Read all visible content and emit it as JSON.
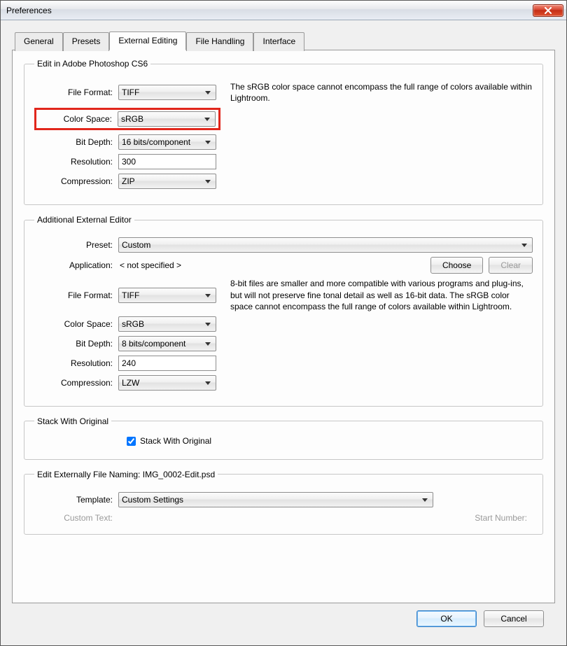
{
  "window": {
    "title": "Preferences"
  },
  "tabs": [
    "General",
    "Presets",
    "External Editing",
    "File Handling",
    "Interface"
  ],
  "active_tab_index": 2,
  "section1": {
    "legend": "Edit in Adobe Photoshop CS6",
    "file_format_label": "File Format:",
    "file_format_value": "TIFF",
    "color_space_label": "Color Space:",
    "color_space_value": "sRGB",
    "bit_depth_label": "Bit Depth:",
    "bit_depth_value": "16 bits/component",
    "resolution_label": "Resolution:",
    "resolution_value": "300",
    "compression_label": "Compression:",
    "compression_value": "ZIP",
    "info": "The sRGB color space cannot encompass the full range of colors available within Lightroom."
  },
  "section2": {
    "legend": "Additional External Editor",
    "preset_label": "Preset:",
    "preset_value": "Custom",
    "application_label": "Application:",
    "application_value": "< not specified >",
    "choose_label": "Choose",
    "clear_label": "Clear",
    "file_format_label": "File Format:",
    "file_format_value": "TIFF",
    "color_space_label": "Color Space:",
    "color_space_value": "sRGB",
    "bit_depth_label": "Bit Depth:",
    "bit_depth_value": "8 bits/component",
    "resolution_label": "Resolution:",
    "resolution_value": "240",
    "compression_label": "Compression:",
    "compression_value": "LZW",
    "info": "8-bit files are smaller and more compatible with various programs and plug-ins, but will not preserve fine tonal detail as well as 16-bit data. The sRGB color space cannot encompass the full range of colors available within Lightroom."
  },
  "section3": {
    "legend": "Stack With Original",
    "checkbox_label": "Stack With Original",
    "checked": true
  },
  "section4": {
    "legend_prefix": "Edit Externally File Naming:",
    "filename": "IMG_0002-Edit.psd",
    "template_label": "Template:",
    "template_value": "Custom Settings",
    "custom_text_label": "Custom Text:",
    "start_number_label": "Start Number:"
  },
  "footer": {
    "ok": "OK",
    "cancel": "Cancel"
  }
}
